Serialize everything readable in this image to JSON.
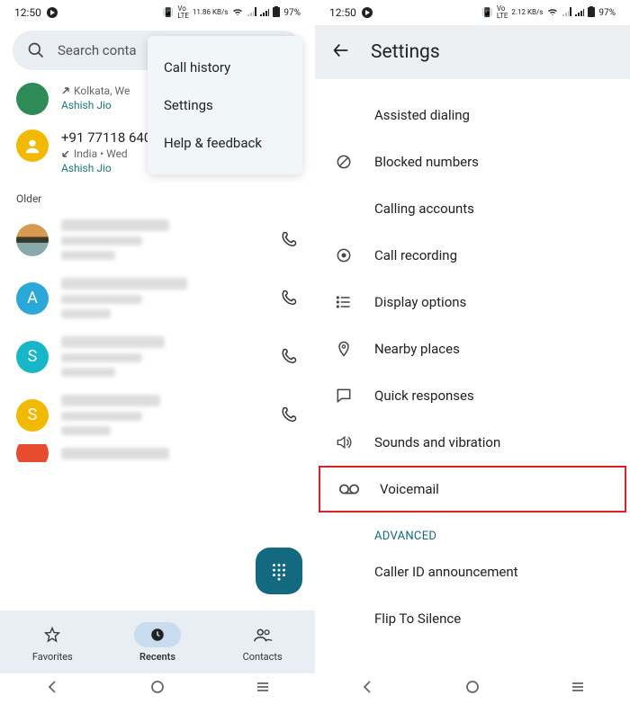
{
  "statusbar": {
    "time": "12:50",
    "net_left": "11.86 KB/s",
    "net_right": "2.12 KB/s",
    "battery": "97%",
    "lte": "LTE"
  },
  "left": {
    "search_placeholder": "Search conta",
    "menu": {
      "history": "Call history",
      "settings": "Settings",
      "help": "Help & feedback"
    },
    "entry1": {
      "loc": "Kolkata, We",
      "sim": "Ashish Jio"
    },
    "entry2": {
      "number": "+91 77118 640",
      "loc": "India • Wed",
      "sim": "Ashish Jio"
    },
    "older": "Older",
    "nav": {
      "favorites": "Favorites",
      "recents": "Recents",
      "contacts": "Contacts"
    }
  },
  "right": {
    "title": "Settings",
    "items": {
      "assisted": "Assisted dialing",
      "blocked": "Blocked numbers",
      "accounts": "Calling accounts",
      "recording": "Call recording",
      "display": "Display options",
      "nearby": "Nearby places",
      "quick": "Quick responses",
      "sounds": "Sounds and vibration",
      "voicemail": "Voicemail",
      "advanced": "ADVANCED",
      "callerid": "Caller ID announcement",
      "flip": "Flip To Silence"
    }
  }
}
